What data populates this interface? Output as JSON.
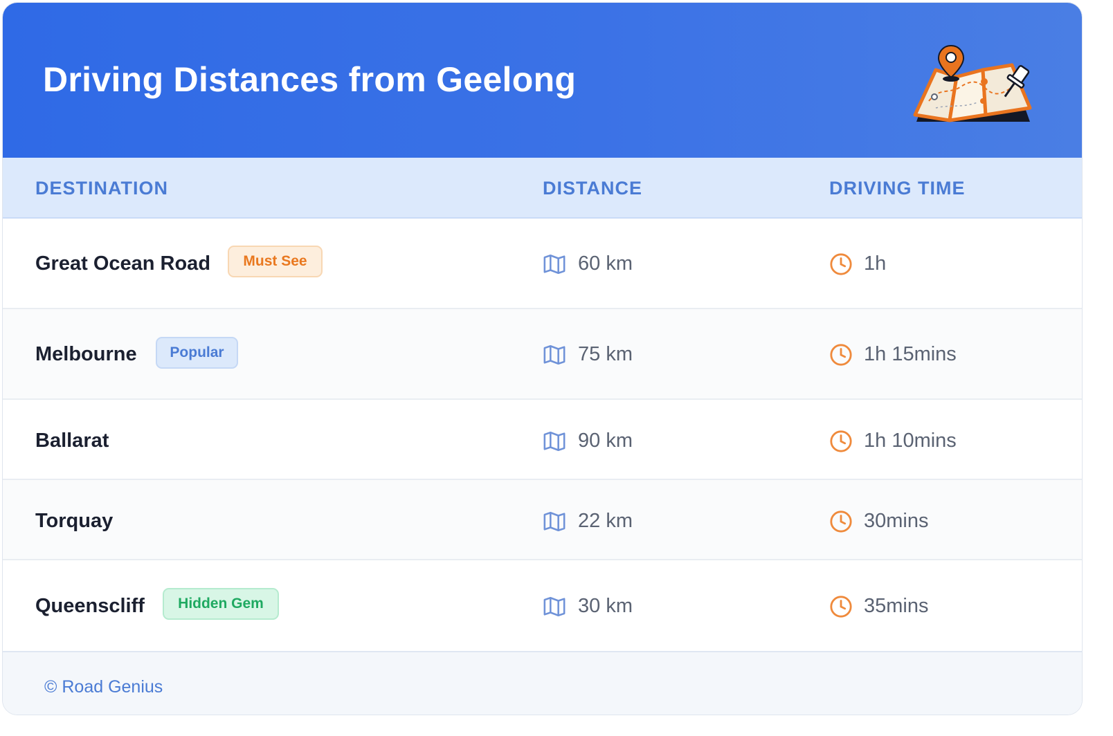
{
  "header": {
    "title": "Driving Distances from Geelong",
    "illustration": "folded-map-with-pins-icon"
  },
  "table": {
    "columns": [
      "DESTINATION",
      "DISTANCE",
      "DRIVING TIME"
    ],
    "rows": [
      {
        "destination": "Great Ocean Road",
        "badge": "Must See",
        "badge_color": "orange",
        "distance": "60 km",
        "time": "1h"
      },
      {
        "destination": "Melbourne",
        "badge": "Popular",
        "badge_color": "blue",
        "distance": "75 km",
        "time": "1h 15mins"
      },
      {
        "destination": "Ballarat",
        "badge": "",
        "badge_color": "",
        "distance": "90 km",
        "time": "1h 10mins"
      },
      {
        "destination": "Torquay",
        "badge": "",
        "badge_color": "",
        "distance": "22 km",
        "time": "30mins"
      },
      {
        "destination": "Queenscliff",
        "badge": "Hidden Gem",
        "badge_color": "green",
        "distance": "30 km",
        "time": "35mins"
      }
    ],
    "distance_icon": "map-icon",
    "time_icon": "clock-icon"
  },
  "footer": {
    "credit": "© Road Genius"
  },
  "colors": {
    "header_gradient_start": "#2f6ae6",
    "header_gradient_end": "#4a7ee4",
    "accent_blue": "#4a7bd4",
    "accent_orange": "#e9781f",
    "accent_green": "#1fa961"
  }
}
